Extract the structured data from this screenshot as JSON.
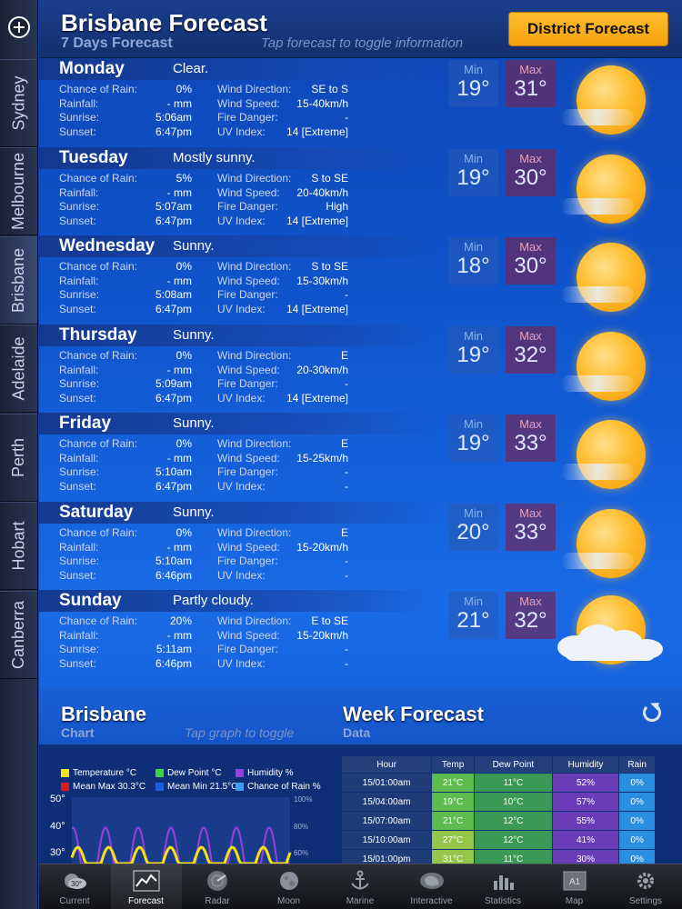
{
  "header": {
    "title": "Brisbane Forecast",
    "subtitle": "7 Days Forecast",
    "hint": "Tap forecast to toggle information",
    "district_button": "District Forecast"
  },
  "sidebar": {
    "cities": [
      "Sydney",
      "Melbourne",
      "Brisbane",
      "Adelaide",
      "Perth",
      "Hobart",
      "Canberra"
    ],
    "active": "Brisbane"
  },
  "labels": {
    "chance_of_rain": "Chance of Rain:",
    "rainfall": "Rainfall:",
    "sunrise": "Sunrise:",
    "sunset": "Sunset:",
    "wind_direction": "Wind Direction:",
    "wind_speed": "Wind Speed:",
    "fire_danger": "Fire Danger:",
    "uv_index": "UV Index:",
    "min": "Min",
    "max": "Max"
  },
  "days": [
    {
      "name": "Monday",
      "summary": "Clear.",
      "chance_of_rain": "0%",
      "rainfall": "- mm",
      "sunrise": "5:06am",
      "sunset": "6:47pm",
      "wind_direction": "SE to S",
      "wind_speed": "15-40km/h",
      "fire_danger": "-",
      "uv_index": "14 [Extreme]",
      "min": "19°",
      "max": "31°",
      "icon": "sunny-haze-icon"
    },
    {
      "name": "Tuesday",
      "summary": "Mostly sunny.",
      "chance_of_rain": "5%",
      "rainfall": "- mm",
      "sunrise": "5:07am",
      "sunset": "6:47pm",
      "wind_direction": "S to SE",
      "wind_speed": "20-40km/h",
      "fire_danger": "High",
      "uv_index": "14 [Extreme]",
      "min": "19°",
      "max": "30°",
      "icon": "sunny-haze-icon"
    },
    {
      "name": "Wednesday",
      "summary": "Sunny.",
      "chance_of_rain": "0%",
      "rainfall": "- mm",
      "sunrise": "5:08am",
      "sunset": "6:47pm",
      "wind_direction": "S to SE",
      "wind_speed": "15-30km/h",
      "fire_danger": "-",
      "uv_index": "14 [Extreme]",
      "min": "18°",
      "max": "30°",
      "icon": "sunny-haze-icon"
    },
    {
      "name": "Thursday",
      "summary": "Sunny.",
      "chance_of_rain": "0%",
      "rainfall": "- mm",
      "sunrise": "5:09am",
      "sunset": "6:47pm",
      "wind_direction": "E",
      "wind_speed": "20-30km/h",
      "fire_danger": "-",
      "uv_index": "14 [Extreme]",
      "min": "19°",
      "max": "32°",
      "icon": "sunny-haze-icon"
    },
    {
      "name": "Friday",
      "summary": "Sunny.",
      "chance_of_rain": "0%",
      "rainfall": "- mm",
      "sunrise": "5:10am",
      "sunset": "6:47pm",
      "wind_direction": "E",
      "wind_speed": "15-25km/h",
      "fire_danger": "-",
      "uv_index": "-",
      "min": "19°",
      "max": "33°",
      "icon": "sunny-haze-icon"
    },
    {
      "name": "Saturday",
      "summary": "Sunny.",
      "chance_of_rain": "0%",
      "rainfall": "- mm",
      "sunrise": "5:10am",
      "sunset": "6:46pm",
      "wind_direction": "E",
      "wind_speed": "15-20km/h",
      "fire_danger": "-",
      "uv_index": "-",
      "min": "20°",
      "max": "33°",
      "icon": "sunny-haze-icon"
    },
    {
      "name": "Sunday",
      "summary": "Partly cloudy.",
      "chance_of_rain": "20%",
      "rainfall": "- mm",
      "sunrise": "5:11am",
      "sunset": "6:46pm",
      "wind_direction": "E to SE",
      "wind_speed": "15-20km/h",
      "fire_danger": "-",
      "uv_index": "-",
      "min": "21°",
      "max": "32°",
      "icon": "partly-cloudy-icon"
    }
  ],
  "bottom": {
    "chart_title": "Brisbane",
    "chart_sub": "Chart",
    "chart_hint": "Tap graph to toggle",
    "data_title": "Week Forecast",
    "data_sub": "Data"
  },
  "chart_legend": [
    {
      "label": "Temperature °C",
      "color": "#f5e214"
    },
    {
      "label": "Dew Point °C",
      "color": "#3fd14a"
    },
    {
      "label": "Humidity %",
      "color": "#9b3fe0"
    },
    {
      "label": "Mean Max 30.3°C",
      "color": "#e01a1a"
    },
    {
      "label": "Mean Min 21.5°C",
      "color": "#1a5ee0"
    },
    {
      "label": "Chance of Rain %",
      "color": "#3fa0f0"
    }
  ],
  "chart_axis": {
    "left_ticks": [
      "50°",
      "40°",
      "30°"
    ],
    "right_ticks": [
      "100%",
      "80%",
      "60%"
    ]
  },
  "table": {
    "headers": [
      "Hour",
      "Temp",
      "Dew Point",
      "Humidity",
      "Rain"
    ],
    "rows": [
      [
        "15/01:00am",
        "21°C",
        "11°C",
        "52%",
        "0%"
      ],
      [
        "15/04:00am",
        "19°C",
        "10°C",
        "57%",
        "0%"
      ],
      [
        "15/07:00am",
        "21°C",
        "12°C",
        "55%",
        "0%"
      ],
      [
        "15/10:00am",
        "27°C",
        "12°C",
        "41%",
        "0%"
      ],
      [
        "15/01:00pm",
        "31°C",
        "11°C",
        "30%",
        "0%"
      ]
    ]
  },
  "tabs": [
    {
      "label": "Current",
      "icon": "current-weather-icon"
    },
    {
      "label": "Forecast",
      "icon": "forecast-graph-icon"
    },
    {
      "label": "Radar",
      "icon": "radar-icon"
    },
    {
      "label": "Moon",
      "icon": "moon-icon"
    },
    {
      "label": "Marine",
      "icon": "anchor-icon"
    },
    {
      "label": "Interactive",
      "icon": "interactive-map-icon"
    },
    {
      "label": "Statistics",
      "icon": "statistics-icon"
    },
    {
      "label": "Map",
      "icon": "map-icon"
    },
    {
      "label": "Settings",
      "icon": "gear-icon"
    }
  ],
  "active_tab": "Forecast",
  "current_tab_badge": "30°",
  "map_tab_badge": "A1"
}
